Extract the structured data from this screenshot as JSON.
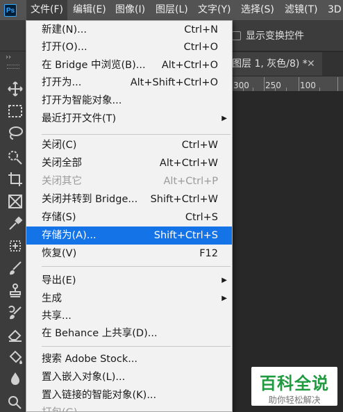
{
  "app": {
    "logo_text": "Ps"
  },
  "menubar": {
    "items": [
      "文件(F)",
      "编辑(E)",
      "图像(I)",
      "图层(L)",
      "文字(Y)",
      "选择(S)",
      "滤镜(T)",
      "3D"
    ],
    "active_index": 0
  },
  "options_bar": {
    "transform_controls_label": "显示变换控件"
  },
  "toolbar": {
    "collapse_glyph": "››"
  },
  "document": {
    "tab_title": "图层 1, 灰色/8) *",
    "ruler_labels": [
      "300",
      "250",
      "100"
    ]
  },
  "file_menu": {
    "items": [
      {
        "label": "新建(N)...",
        "shortcut": "Ctrl+N"
      },
      {
        "label": "打开(O)...",
        "shortcut": "Ctrl+O"
      },
      {
        "label": "在 Bridge 中浏览(B)...",
        "shortcut": "Alt+Ctrl+O"
      },
      {
        "label": "打开为...",
        "shortcut": "Alt+Shift+Ctrl+O"
      },
      {
        "label": "打开为智能对象...",
        "shortcut": ""
      },
      {
        "label": "最近打开文件(T)",
        "shortcut": "",
        "submenu": true
      },
      {
        "label": "关闭(C)",
        "shortcut": "Ctrl+W"
      },
      {
        "label": "关闭全部",
        "shortcut": "Alt+Ctrl+W"
      },
      {
        "label": "关闭其它",
        "shortcut": "Alt+Ctrl+P",
        "disabled": true
      },
      {
        "label": "关闭并转到 Bridge...",
        "shortcut": "Shift+Ctrl+W"
      },
      {
        "label": "存储(S)",
        "shortcut": "Ctrl+S"
      },
      {
        "label": "存储为(A)...",
        "shortcut": "Shift+Ctrl+S",
        "highlighted": true
      },
      {
        "label": "恢复(V)",
        "shortcut": "F12"
      },
      {
        "label": "导出(E)",
        "shortcut": "",
        "submenu": true
      },
      {
        "label": "生成",
        "shortcut": "",
        "submenu": true
      },
      {
        "label": "共享...",
        "shortcut": ""
      },
      {
        "label": "在 Behance 上共享(D)...",
        "shortcut": ""
      },
      {
        "label": "搜索 Adobe Stock...",
        "shortcut": ""
      },
      {
        "label": "置入嵌入对象(L)...",
        "shortcut": ""
      },
      {
        "label": "置入链接的智能对象(K)...",
        "shortcut": ""
      },
      {
        "label": "打包(G)...",
        "shortcut": "",
        "disabled": true
      }
    ],
    "submenu_glyph": "▶"
  },
  "watermark": {
    "title": "百科全说",
    "subtitle": "助你轻松解决"
  },
  "colors": {
    "menubar": "#535353",
    "menu_bg": "#f2f2f2",
    "highlight": "#1473e6",
    "panel": "#3c3c3c",
    "canvas": "#282828",
    "watermark_green": "#1f9a3f"
  }
}
